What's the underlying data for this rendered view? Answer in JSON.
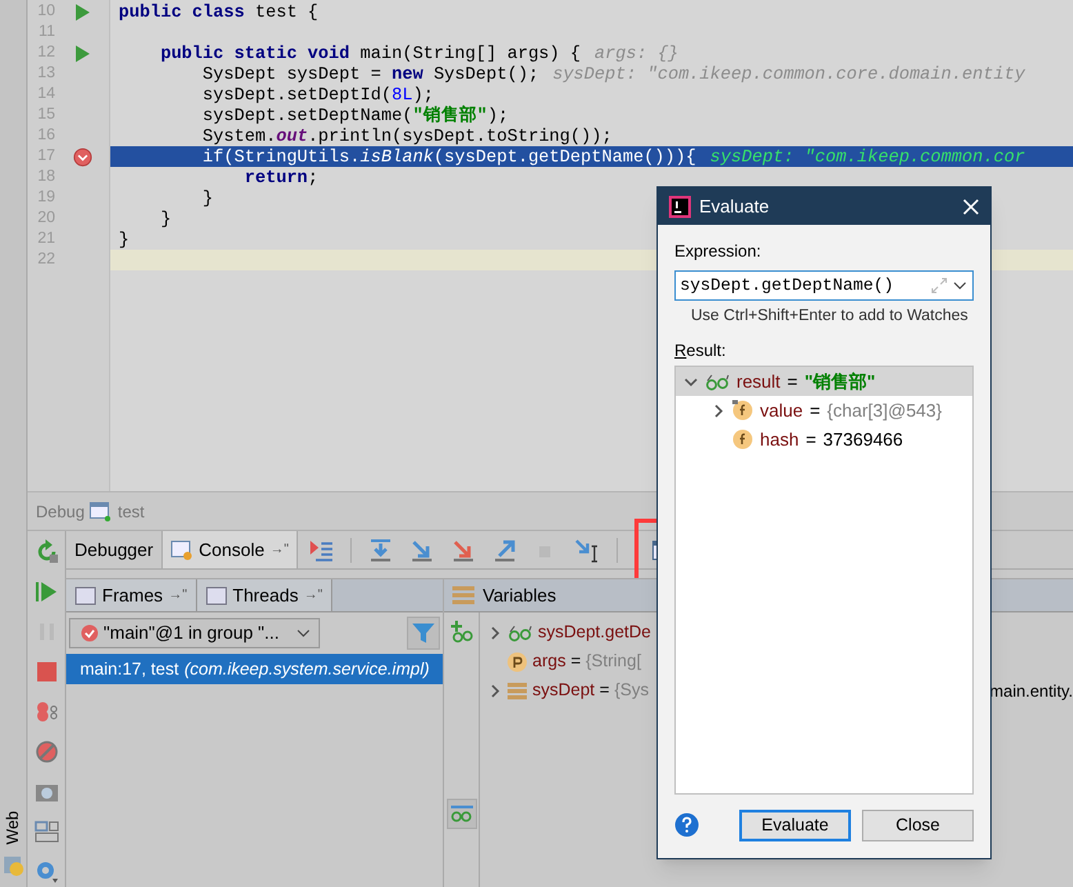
{
  "editor": {
    "lines": [
      {
        "number": "10",
        "run_marker": true,
        "breakpoint": false,
        "current": false,
        "caret_line": false,
        "tokens": [
          {
            "kind": "keyword",
            "text": "public class "
          },
          {
            "kind": "plain",
            "text": "test {"
          }
        ]
      },
      {
        "number": "11",
        "run_marker": false,
        "breakpoint": false,
        "current": false,
        "caret_line": false
      },
      {
        "number": "12",
        "run_marker": true,
        "breakpoint": false,
        "current": false,
        "caret_line": false,
        "tokens": [
          {
            "kind": "keyword",
            "text": "    public static void "
          },
          {
            "kind": "plain",
            "text": "main(String[] args) {"
          }
        ],
        "hint": "args: {}"
      },
      {
        "number": "13",
        "run_marker": false,
        "breakpoint": false,
        "current": false,
        "caret_line": false,
        "tokens": [
          {
            "kind": "plain",
            "text": "        SysDept sysDept = "
          },
          {
            "kind": "keyword",
            "text": "new "
          },
          {
            "kind": "plain",
            "text": "SysDept();"
          }
        ],
        "hint": "sysDept: \"com.ikeep.common.core.domain.entity"
      },
      {
        "number": "14",
        "run_marker": false,
        "breakpoint": false,
        "current": false,
        "caret_line": false,
        "tokens": [
          {
            "kind": "plain",
            "text": "        sysDept.setDeptId("
          },
          {
            "kind": "number",
            "text": "8L"
          },
          {
            "kind": "plain",
            "text": ");"
          }
        ]
      },
      {
        "number": "15",
        "run_marker": false,
        "breakpoint": false,
        "current": false,
        "caret_line": false,
        "tokens": [
          {
            "kind": "plain",
            "text": "        sysDept.setDeptName("
          },
          {
            "kind": "string",
            "text": "\"销售部\""
          },
          {
            "kind": "plain",
            "text": ");"
          }
        ]
      },
      {
        "number": "16",
        "run_marker": false,
        "breakpoint": false,
        "current": false,
        "caret_line": false,
        "tokens": [
          {
            "kind": "plain",
            "text": "        System."
          },
          {
            "kind": "static_field",
            "text": "out"
          },
          {
            "kind": "plain",
            "text": ".println(sysDept.toString());"
          }
        ]
      },
      {
        "number": "17",
        "run_marker": false,
        "breakpoint": true,
        "current": true,
        "caret_line": false,
        "tokens": [
          {
            "kind": "plain",
            "text": "        if(StringUtils."
          },
          {
            "kind": "static_call",
            "text": "isBlank"
          },
          {
            "kind": "plain",
            "text": "(sysDept.getDeptName())){"
          }
        ],
        "hint": "sysDept: \"com.ikeep.common.cor"
      },
      {
        "number": "18",
        "run_marker": false,
        "breakpoint": false,
        "current": false,
        "caret_line": false,
        "tokens": [
          {
            "kind": "keyword",
            "text": "            return"
          },
          {
            "kind": "plain",
            "text": ";"
          }
        ]
      },
      {
        "number": "19",
        "run_marker": false,
        "breakpoint": false,
        "current": false,
        "caret_line": false,
        "tokens": [
          {
            "kind": "plain",
            "text": "        }"
          }
        ]
      },
      {
        "number": "20",
        "run_marker": false,
        "breakpoint": false,
        "current": false,
        "caret_line": false,
        "tokens": [
          {
            "kind": "plain",
            "text": "    }"
          }
        ]
      },
      {
        "number": "21",
        "run_marker": false,
        "breakpoint": false,
        "current": false,
        "caret_line": false,
        "tokens": [
          {
            "kind": "plain",
            "text": "}"
          }
        ]
      },
      {
        "number": "22",
        "run_marker": false,
        "breakpoint": false,
        "current": false,
        "caret_line": true
      }
    ]
  },
  "debug_panel": {
    "label": "Debug",
    "config": "test",
    "tabs": [
      {
        "label": "Debugger",
        "selected": true
      },
      {
        "label": "Console",
        "selected": false,
        "pin": "→\""
      }
    ],
    "frames_tabs": [
      {
        "label": "Frames",
        "pin": "→\""
      },
      {
        "label": "Threads",
        "pin": "→\""
      }
    ],
    "thread_select": {
      "value": "\"main\"@1 in group \"..."
    },
    "frames": [
      {
        "location": "main:17, test",
        "package": "(com.ikeep.system.service.impl)",
        "selected": true
      }
    ],
    "variables_title": "Variables",
    "variables": [
      {
        "kind": "watch",
        "name": "sysDept.getDe",
        "expanded": false
      },
      {
        "kind": "param",
        "name": "args",
        "separator": "=",
        "value": "{String["
      },
      {
        "kind": "object",
        "name": "sysDept",
        "separator": "=",
        "value": "{Sys",
        "tail": "main.entity.",
        "expanded": false
      }
    ]
  },
  "side_label": "Web",
  "dialog": {
    "title": "Evaluate",
    "expression_label": "Expression:",
    "expression": "sysDept.getDeptName()",
    "hint": "Use Ctrl+Shift+Enter to add to Watches",
    "result_label": "Result:",
    "result": [
      {
        "kind": "watch",
        "name": "result",
        "separator": "=",
        "value": "\"销售部\"",
        "color": "#008000",
        "expanded": true,
        "selected": true,
        "children": [
          {
            "kind": "field",
            "name": "value",
            "separator": "=",
            "value": "{char[3]@543}",
            "color": "#808080",
            "expanded": false,
            "selected": false,
            "locked": true
          },
          {
            "kind": "field",
            "name": "hash",
            "separator": "=",
            "value": "37369466",
            "color": "#000000",
            "selected": false,
            "locked": false
          }
        ]
      }
    ],
    "buttons": [
      {
        "label": "Evaluate",
        "default": true
      },
      {
        "label": "Close",
        "default": false
      }
    ]
  }
}
